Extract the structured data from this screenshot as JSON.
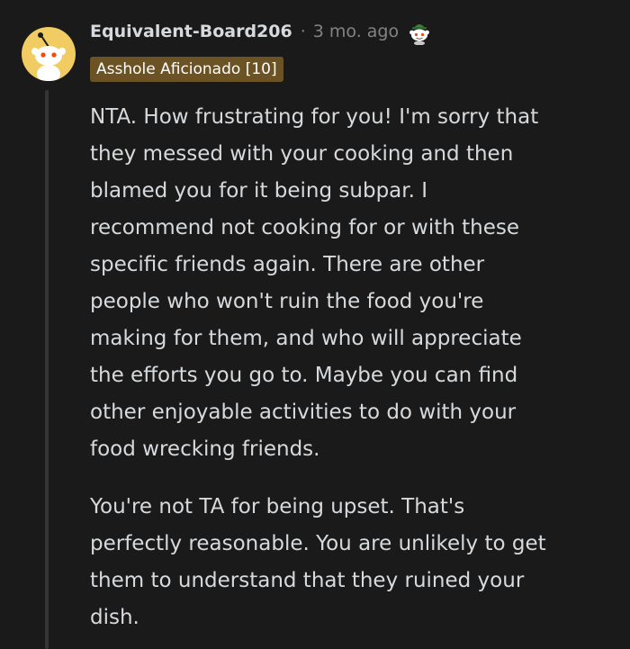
{
  "comment": {
    "author": "Equivalent-Board206",
    "separator": "·",
    "timestamp": "3 mo. ago",
    "flair": "Asshole Aficionado [10]",
    "avatar_icon": "snoo-avatar-icon",
    "award_icon": "snoo-award-icon",
    "paragraphs": [
      "NTA. How frustrating for you! I'm sorry that\nthey messed with your cooking and then\nblamed you for it being subpar. I\nrecommend not cooking for or with these\nspecific friends again. There are other\npeople who won't ruin the food you're\nmaking for them, and who will appreciate\nthe efforts you go to. Maybe you can find\nother enjoyable activities to do with your\nfood wrecking friends.",
      "You're not TA for being upset. That's\nperfectly reasonable. You are unlikely to get\nthem to understand that they ruined your\ndish."
    ]
  },
  "colors": {
    "background": "#1a1a1b",
    "text": "#d7dadc",
    "muted": "#818384",
    "flair_bg": "#6b5325",
    "avatar_bg": "#f0cc63",
    "thread_line": "#343536"
  }
}
